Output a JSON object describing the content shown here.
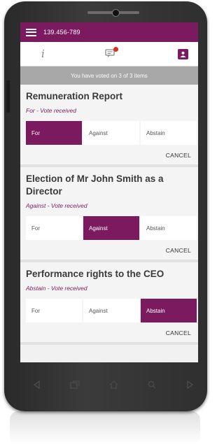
{
  "app": {
    "phone_number": "139.456-789"
  },
  "status": {
    "voted_text": "You have voted on 3 of 3 items"
  },
  "items": [
    {
      "title": "Remuneration Report",
      "status": "For - Vote received",
      "options": [
        "For",
        "Against",
        "Abstain"
      ],
      "selected": 0,
      "cancel": "CANCEL"
    },
    {
      "title": "Election of Mr John Smith as a Director",
      "status": "Against - Vote received",
      "options": [
        "For",
        "Against",
        "Abstain"
      ],
      "selected": 1,
      "cancel": "CANCEL"
    },
    {
      "title": "Performance rights to the CEO",
      "status": "Abstain - Vote received",
      "options": [
        "For",
        "Against",
        "Abstain"
      ],
      "selected": 2,
      "cancel": "CANCEL"
    }
  ],
  "icons": {
    "menu": "hamburger-icon",
    "info": "info-icon",
    "messages": "chat-icon",
    "account": "account-icon",
    "back": "back-icon",
    "recents": "recents-icon",
    "home": "home-icon",
    "search": "search-icon",
    "forward": "forward-icon"
  },
  "colors": {
    "brand": "#7b1a5f",
    "notification": "#d93025",
    "status_bar": "#a8a8a8"
  }
}
